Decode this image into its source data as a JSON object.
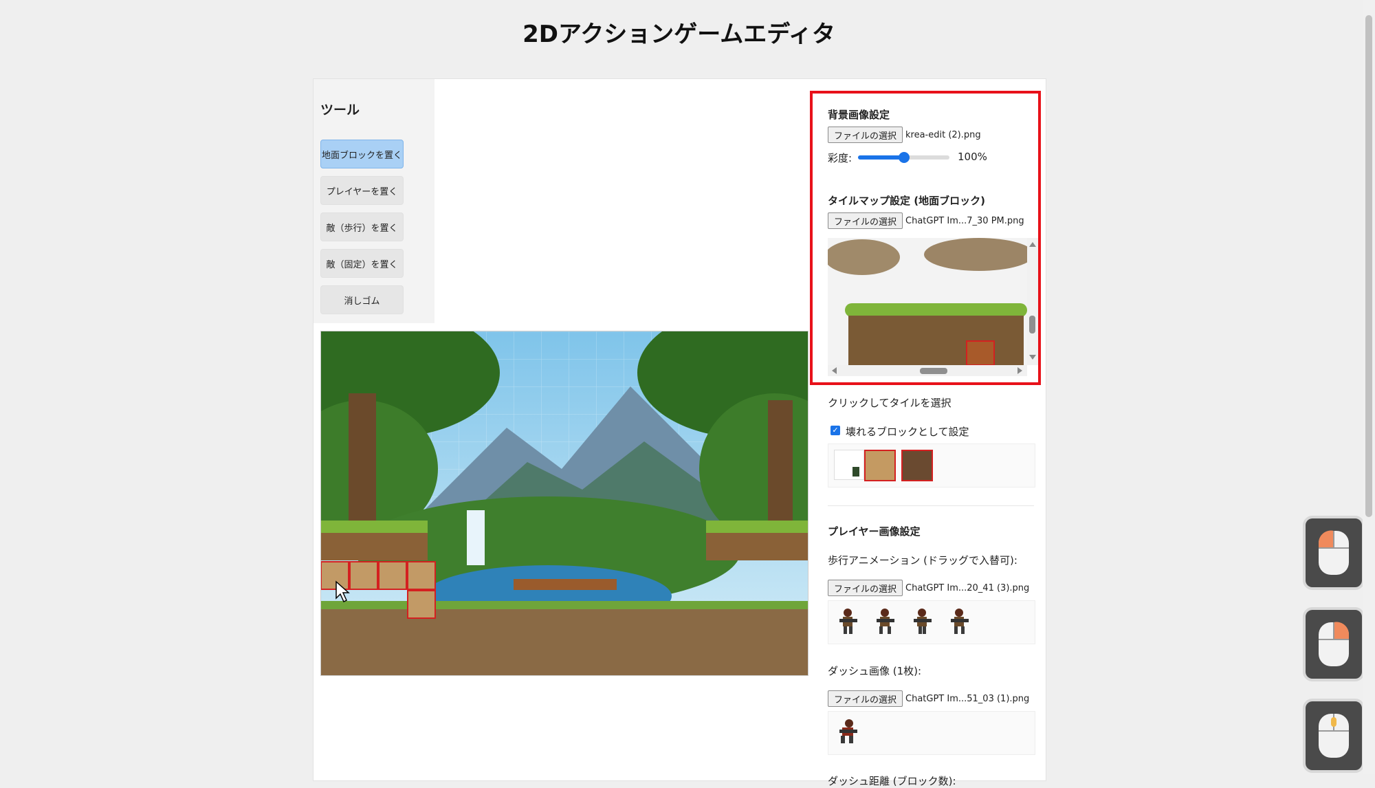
{
  "page": {
    "title": "2Dアクションゲームエディタ"
  },
  "tools": {
    "heading": "ツール",
    "buttons": [
      {
        "label": "地面ブロックを置く",
        "active": true
      },
      {
        "label": "プレイヤーを置く",
        "active": false
      },
      {
        "label": "敵（歩行）を置く",
        "active": false
      },
      {
        "label": "敵（固定）を置く",
        "active": false
      },
      {
        "label": "消しゴム",
        "active": false
      }
    ]
  },
  "background": {
    "heading": "背景画像設定",
    "file_button": "ファイルの選択",
    "file_name": "krea-edit (2).png",
    "saturation_label": "彩度:",
    "saturation_value": "100%",
    "saturation_fraction": 0.5
  },
  "tilemap": {
    "heading": "タイルマップ設定 (地面ブロック)",
    "file_button": "ファイルの選択",
    "file_name": "ChatGPT Im...7_30 PM.png",
    "hint": "クリックしてタイルを選択",
    "breakable_label": "壊れるブロックとして設定",
    "breakable_checked": true
  },
  "player": {
    "heading": "プレイヤー画像設定",
    "walk_label": "歩行アニメーション (ドラッグで入替可):",
    "walk_file_button": "ファイルの選択",
    "walk_file_name": "ChatGPT Im...20_41 (3).png",
    "dash_label": "ダッシュ画像 (1枚):",
    "dash_file_button": "ファイルの選択",
    "dash_file_name": "ChatGPT Im...51_03 (1).png",
    "dash_distance_label": "ダッシュ距離 (ブロック数):"
  },
  "colors": {
    "accent": "#1a73e8",
    "highlight_border": "#e8111a",
    "active_tool": "#a9d0f5"
  }
}
